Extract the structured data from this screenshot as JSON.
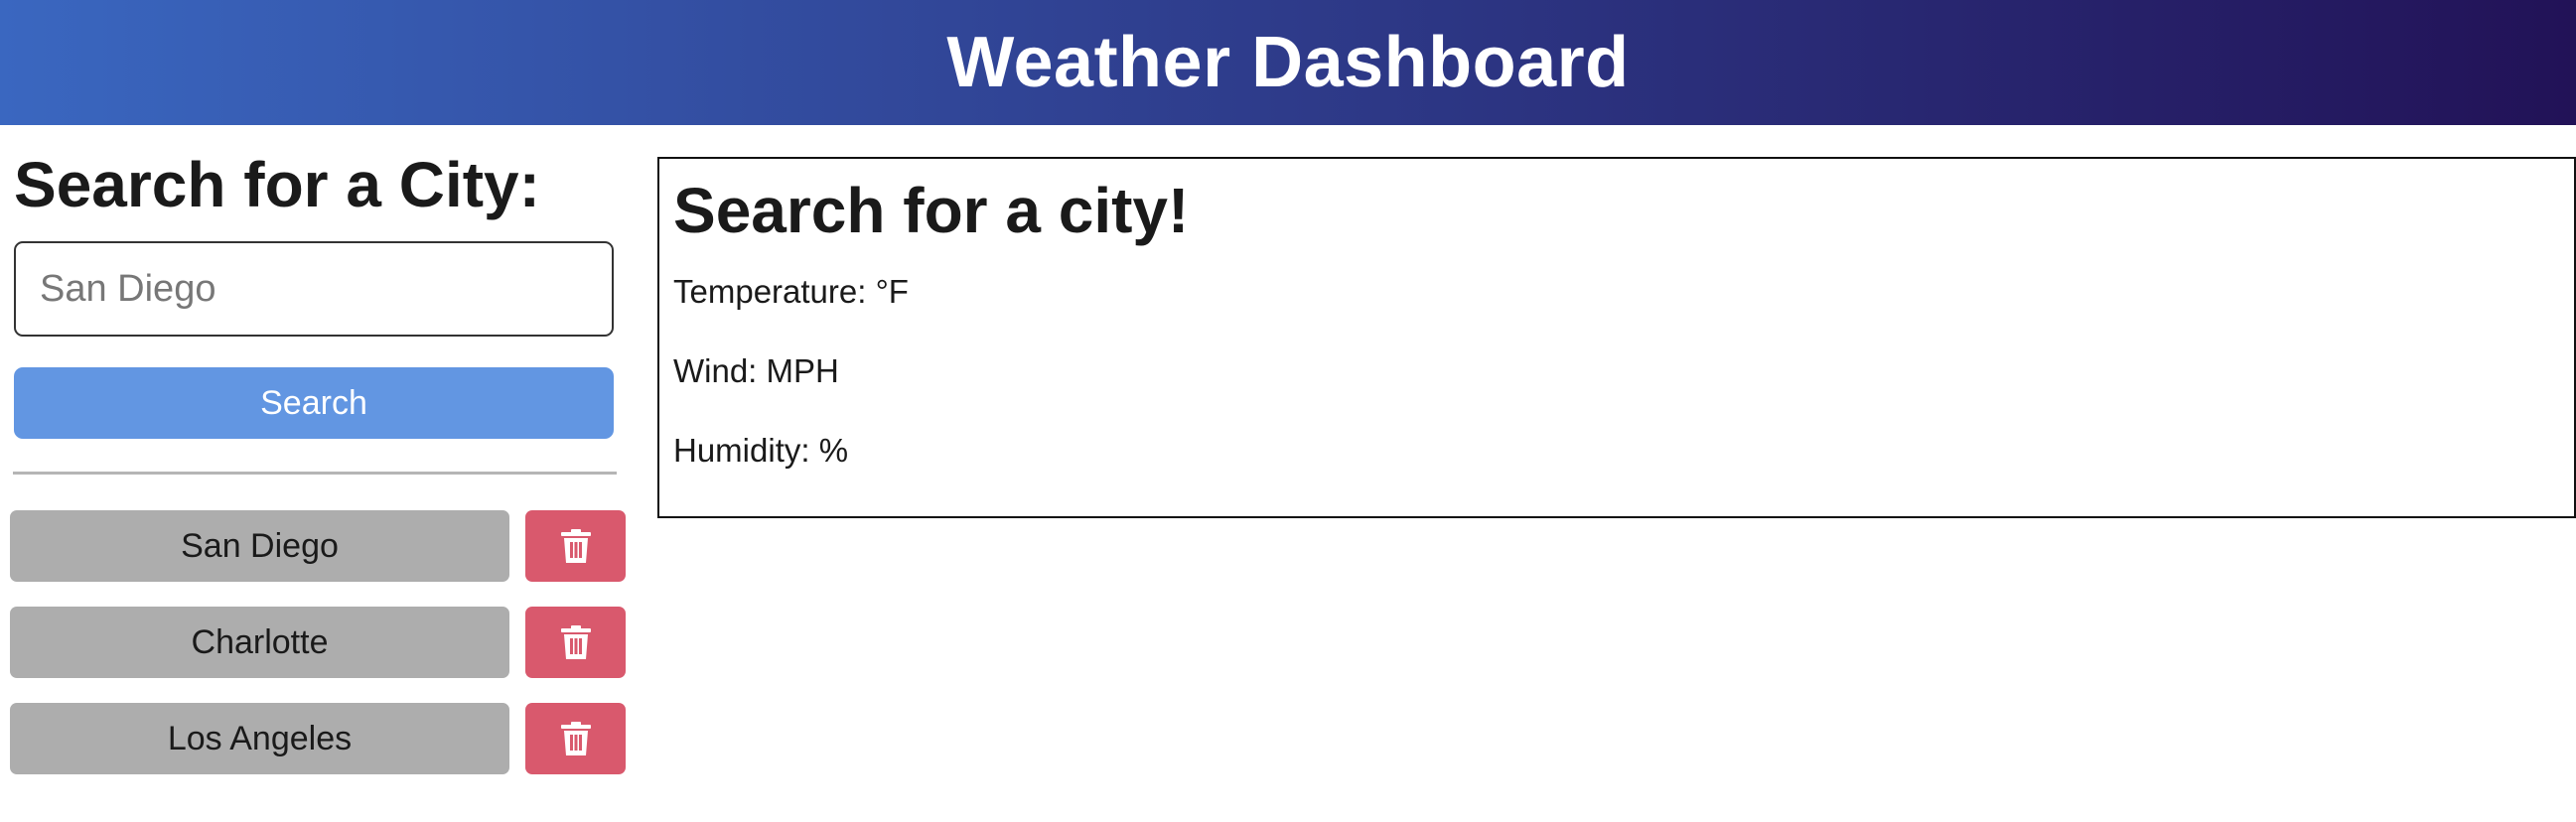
{
  "header": {
    "title": "Weather Dashboard"
  },
  "sidebar": {
    "title": "Search for a City:",
    "search_placeholder": "San Diego",
    "search_value": "",
    "search_button_label": "Search",
    "history": [
      {
        "city": "San Diego",
        "delete_icon": "trash-icon"
      },
      {
        "city": "Charlotte",
        "delete_icon": "trash-icon"
      },
      {
        "city": "Los Angeles",
        "delete_icon": "trash-icon"
      }
    ]
  },
  "weather": {
    "title": "Search for a city!",
    "temperature": "Temperature: °F",
    "wind": "Wind: MPH",
    "humidity": "Humidity: %"
  },
  "colors": {
    "header_gradient_start": "#3a67c0",
    "header_gradient_end": "#221257",
    "search_button": "#6296e2",
    "history_button": "#adadad",
    "delete_button": "#d9596d"
  }
}
